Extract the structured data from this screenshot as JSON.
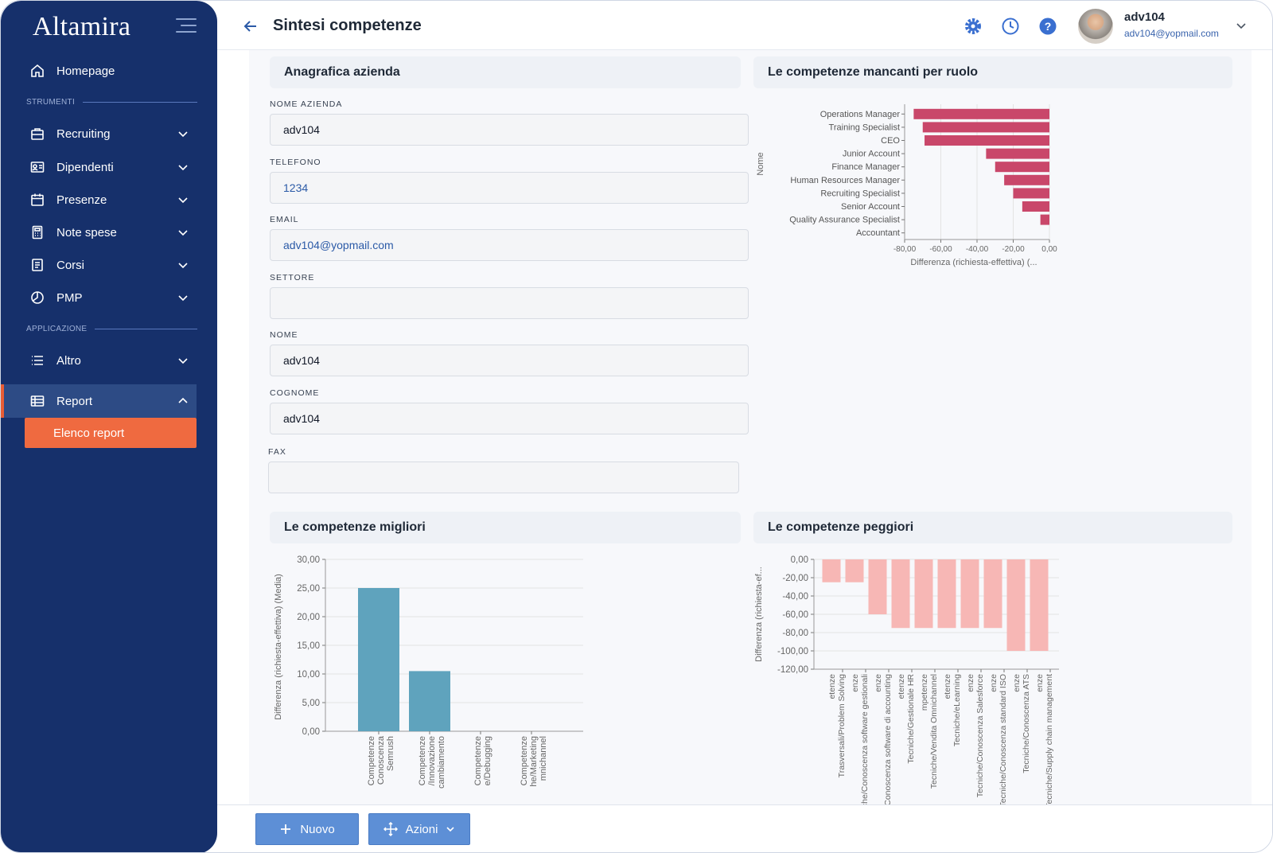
{
  "app": {
    "brand": "Altamira"
  },
  "sidebar": {
    "items": [
      {
        "label": "Homepage",
        "icon": "home-icon"
      },
      {
        "label": "Recruiting",
        "icon": "briefcase-icon"
      },
      {
        "label": "Dipendenti",
        "icon": "id-card-icon"
      },
      {
        "label": "Presenze",
        "icon": "calendar-icon"
      },
      {
        "label": "Note spese",
        "icon": "calculator-icon"
      },
      {
        "label": "Corsi",
        "icon": "book-icon"
      },
      {
        "label": "PMP",
        "icon": "pie-icon"
      },
      {
        "label": "Altro",
        "icon": "list-icon"
      },
      {
        "label": "Report",
        "icon": "table-icon"
      }
    ],
    "sections": {
      "tools": "STRUMENTI",
      "app": "APPLICAZIONE"
    },
    "sub_active": "Elenco report"
  },
  "header": {
    "title": "Sintesi competenze",
    "user_name": "adv104",
    "user_email": "adv104@yopmail.com"
  },
  "form": {
    "card_title": "Anagrafica azienda",
    "fields": [
      {
        "label": "NOME AZIENDA",
        "value": "adv104"
      },
      {
        "label": "TELEFONO",
        "value": "1234"
      },
      {
        "label": "EMAIL",
        "value": "adv104@yopmail.com"
      },
      {
        "label": "SETTORE",
        "value": ""
      },
      {
        "label": "NOME",
        "value": "adv104"
      },
      {
        "label": "COGNOME",
        "value": "adv104"
      },
      {
        "label": "FAX",
        "value": ""
      }
    ]
  },
  "cards": {
    "missing": "Le competenze mancanti per ruolo",
    "best": "Le competenze migliori",
    "worst": "Le competenze peggiori"
  },
  "actions": {
    "new_label": "Nuovo",
    "actions_label": "Azioni"
  },
  "chart_data": [
    {
      "type": "bar",
      "orientation": "horizontal",
      "categories": [
        "Operations Manager",
        "Training Specialist",
        "CEO",
        "Junior Account",
        "Finance Manager",
        "Human Resources Manager",
        "Recruiting Specialist",
        "Senior Account",
        "Quality Assurance Specialist",
        "Accountant"
      ],
      "values": [
        -75,
        -70,
        -69,
        -35,
        -30,
        -25,
        -20,
        -15,
        -5,
        0
      ],
      "xlabel": "Differenza (richiesta-effettiva) (...",
      "ylabel": "Nome",
      "xticks": [
        "-80,00",
        "-60,00",
        "-40,00",
        "-20,00",
        "0,00"
      ],
      "xlim": [
        -80,
        0
      ],
      "color": "#c9476a",
      "grid": true
    },
    {
      "type": "bar",
      "categories": [
        "Competenze Conoscenza Semrush",
        "Competenze /Innovazione cambiamento",
        "Competenze e/Debugging",
        "Competenze he/Marketing mnichannel"
      ],
      "values": [
        25,
        10.5,
        0,
        0
      ],
      "ylabel": "Differenza (richiesta-effettiva) (Media)",
      "yticks": [
        "0,00",
        "5,00",
        "10,00",
        "15,00",
        "20,00",
        "25,00",
        "30,00"
      ],
      "ylim": [
        0,
        30
      ],
      "color": "#5fa3bd",
      "grid": true
    },
    {
      "type": "bar",
      "categories": [
        "etenze Trasversali/Problem Solving",
        "enze Tecniche/Conoscenza software gestionali",
        "enze Tecniche/Conoscenza software di accounting",
        "etenze Tecniche/Gestionale HR",
        "mpetenze Tecniche/Vendita Omnichannel",
        "etenze Tecniche/eLearning",
        "enze Tecniche/Conoscenza Salesforce",
        "enze Tecniche/Conoscenza standard ISO",
        "enze Tecniche/Conoscenza ATS",
        "enze Tecniche/Supply chain management"
      ],
      "values": [
        -25,
        -25,
        -60,
        -75,
        -75,
        -75,
        -75,
        -75,
        -100,
        -100
      ],
      "ylabel": "Differenza (richiesta-ef...",
      "yticks": [
        "-120,00",
        "-100,00",
        "-80,00",
        "-60,00",
        "-40,00",
        "-20,00",
        "0,00"
      ],
      "ylim": [
        -120,
        0
      ],
      "color": "#f7b7b5",
      "grid": true
    }
  ]
}
